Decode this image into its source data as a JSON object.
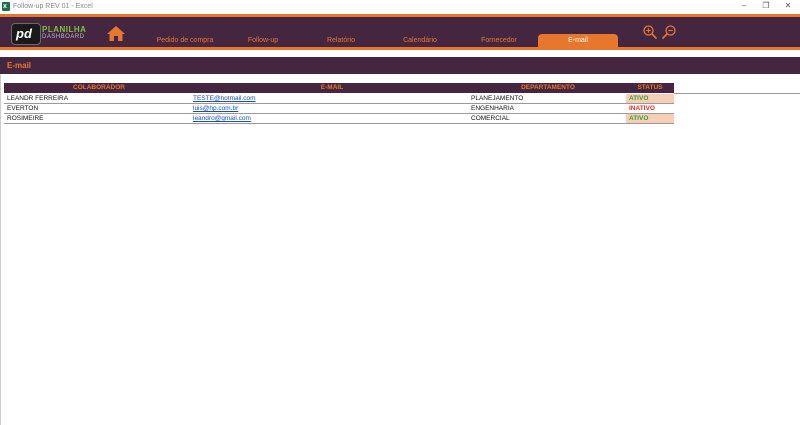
{
  "window": {
    "title": "Follow-up REV 01 - Excel",
    "app_icon": "excel-icon",
    "controls": {
      "minimize": "–",
      "restore": "❐",
      "close": "✕"
    }
  },
  "brand": {
    "logo_mark": "pd",
    "line1": "PLANILHA",
    "line2": "DASHBOARD",
    "accent": "#e8772e",
    "dark": "#452641",
    "green": "#7fc241"
  },
  "nav": {
    "home_icon": "home-icon",
    "tabs": [
      {
        "label": "Pedido de compra"
      },
      {
        "label": "Follow-up"
      },
      {
        "label": "Relatório"
      },
      {
        "label": "Calendário"
      },
      {
        "label": "Fornecedor"
      },
      {
        "label": "E-mail",
        "active": true
      }
    ],
    "zoom_in_icon": "zoom-in-icon",
    "zoom_out_icon": "zoom-out-icon"
  },
  "section": {
    "title": "E-mail"
  },
  "table": {
    "headers": [
      "COLABORADOR",
      "E-MAIL",
      "DEPARTAMENTO",
      "STATUS"
    ],
    "rows": [
      {
        "colaborador": "LEANDR FERREIRA",
        "email": "TESTE@hotmail.com",
        "departamento": "PLANEJAMENTO",
        "status": "ATIVO"
      },
      {
        "colaborador": "EVERTON",
        "email": "luis@hp.com.br",
        "departamento": "ENGENHARIA",
        "status": "INATIVO"
      },
      {
        "colaborador": "ROSIMEIRE",
        "email": "leandro@gmail.com",
        "departamento": "COMERCIAL",
        "status": "ATIVO"
      }
    ],
    "status_colors": {
      "ATIVO": "#3a9d3a",
      "INATIVO": "#e0302a"
    }
  }
}
